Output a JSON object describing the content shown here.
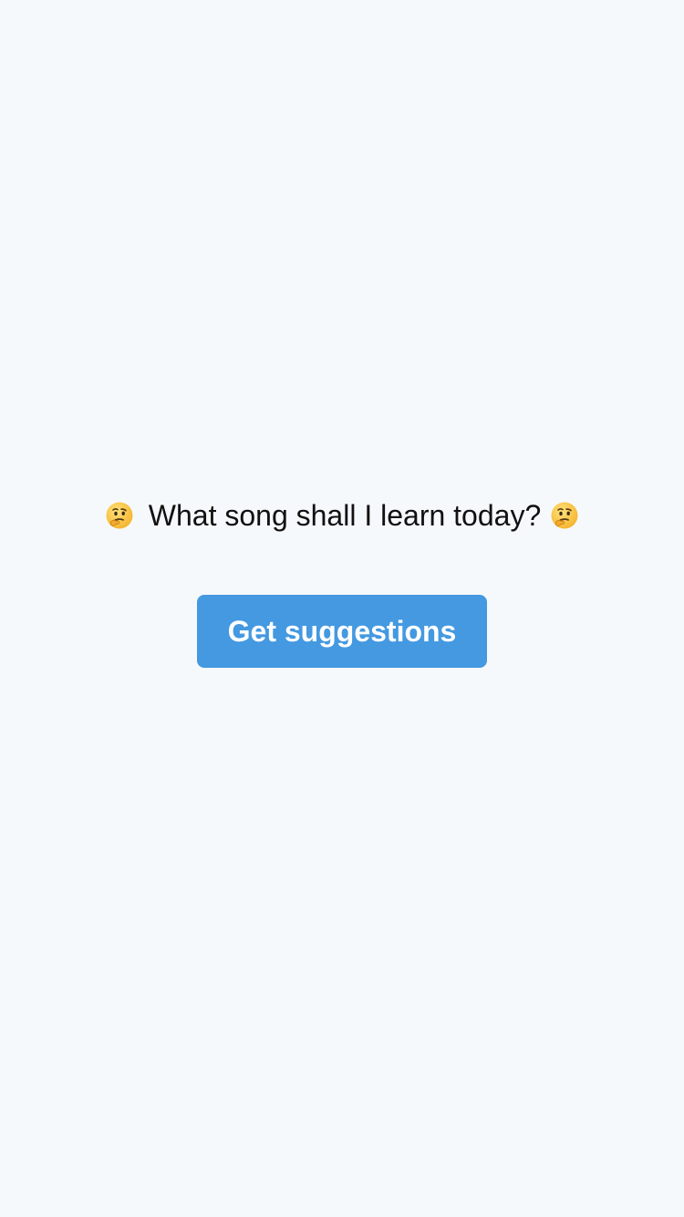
{
  "prompt": {
    "text": "What song shall I learn today?",
    "left_icon": "thinking-face-emoji",
    "right_icon": "thinking-face-emoji"
  },
  "action": {
    "label": "Get suggestions"
  },
  "colors": {
    "background": "#f6f9fb",
    "button": "#4499e1",
    "button_text": "#ffffff",
    "text": "#111111"
  }
}
